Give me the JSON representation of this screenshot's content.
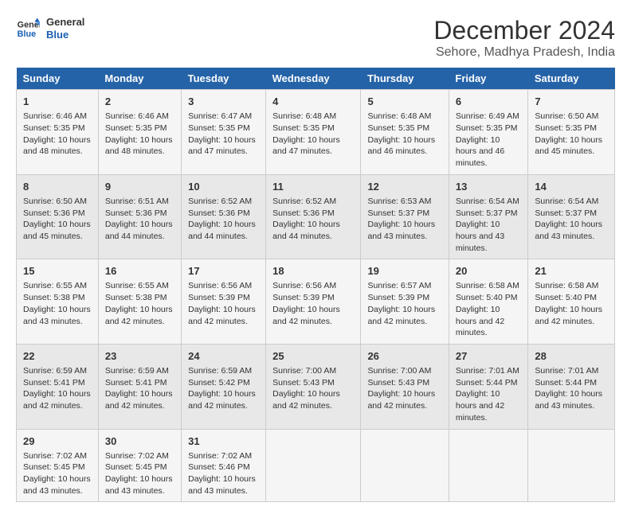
{
  "logo": {
    "line1": "General",
    "line2": "Blue"
  },
  "title": "December 2024",
  "subtitle": "Sehore, Madhya Pradesh, India",
  "days_of_week": [
    "Sunday",
    "Monday",
    "Tuesday",
    "Wednesday",
    "Thursday",
    "Friday",
    "Saturday"
  ],
  "weeks": [
    [
      {
        "day": "1",
        "sunrise": "Sunrise: 6:46 AM",
        "sunset": "Sunset: 5:35 PM",
        "daylight": "Daylight: 10 hours and 48 minutes."
      },
      {
        "day": "2",
        "sunrise": "Sunrise: 6:46 AM",
        "sunset": "Sunset: 5:35 PM",
        "daylight": "Daylight: 10 hours and 48 minutes."
      },
      {
        "day": "3",
        "sunrise": "Sunrise: 6:47 AM",
        "sunset": "Sunset: 5:35 PM",
        "daylight": "Daylight: 10 hours and 47 minutes."
      },
      {
        "day": "4",
        "sunrise": "Sunrise: 6:48 AM",
        "sunset": "Sunset: 5:35 PM",
        "daylight": "Daylight: 10 hours and 47 minutes."
      },
      {
        "day": "5",
        "sunrise": "Sunrise: 6:48 AM",
        "sunset": "Sunset: 5:35 PM",
        "daylight": "Daylight: 10 hours and 46 minutes."
      },
      {
        "day": "6",
        "sunrise": "Sunrise: 6:49 AM",
        "sunset": "Sunset: 5:35 PM",
        "daylight": "Daylight: 10 hours and 46 minutes."
      },
      {
        "day": "7",
        "sunrise": "Sunrise: 6:50 AM",
        "sunset": "Sunset: 5:35 PM",
        "daylight": "Daylight: 10 hours and 45 minutes."
      }
    ],
    [
      {
        "day": "8",
        "sunrise": "Sunrise: 6:50 AM",
        "sunset": "Sunset: 5:36 PM",
        "daylight": "Daylight: 10 hours and 45 minutes."
      },
      {
        "day": "9",
        "sunrise": "Sunrise: 6:51 AM",
        "sunset": "Sunset: 5:36 PM",
        "daylight": "Daylight: 10 hours and 44 minutes."
      },
      {
        "day": "10",
        "sunrise": "Sunrise: 6:52 AM",
        "sunset": "Sunset: 5:36 PM",
        "daylight": "Daylight: 10 hours and 44 minutes."
      },
      {
        "day": "11",
        "sunrise": "Sunrise: 6:52 AM",
        "sunset": "Sunset: 5:36 PM",
        "daylight": "Daylight: 10 hours and 44 minutes."
      },
      {
        "day": "12",
        "sunrise": "Sunrise: 6:53 AM",
        "sunset": "Sunset: 5:37 PM",
        "daylight": "Daylight: 10 hours and 43 minutes."
      },
      {
        "day": "13",
        "sunrise": "Sunrise: 6:54 AM",
        "sunset": "Sunset: 5:37 PM",
        "daylight": "Daylight: 10 hours and 43 minutes."
      },
      {
        "day": "14",
        "sunrise": "Sunrise: 6:54 AM",
        "sunset": "Sunset: 5:37 PM",
        "daylight": "Daylight: 10 hours and 43 minutes."
      }
    ],
    [
      {
        "day": "15",
        "sunrise": "Sunrise: 6:55 AM",
        "sunset": "Sunset: 5:38 PM",
        "daylight": "Daylight: 10 hours and 43 minutes."
      },
      {
        "day": "16",
        "sunrise": "Sunrise: 6:55 AM",
        "sunset": "Sunset: 5:38 PM",
        "daylight": "Daylight: 10 hours and 42 minutes."
      },
      {
        "day": "17",
        "sunrise": "Sunrise: 6:56 AM",
        "sunset": "Sunset: 5:39 PM",
        "daylight": "Daylight: 10 hours and 42 minutes."
      },
      {
        "day": "18",
        "sunrise": "Sunrise: 6:56 AM",
        "sunset": "Sunset: 5:39 PM",
        "daylight": "Daylight: 10 hours and 42 minutes."
      },
      {
        "day": "19",
        "sunrise": "Sunrise: 6:57 AM",
        "sunset": "Sunset: 5:39 PM",
        "daylight": "Daylight: 10 hours and 42 minutes."
      },
      {
        "day": "20",
        "sunrise": "Sunrise: 6:58 AM",
        "sunset": "Sunset: 5:40 PM",
        "daylight": "Daylight: 10 hours and 42 minutes."
      },
      {
        "day": "21",
        "sunrise": "Sunrise: 6:58 AM",
        "sunset": "Sunset: 5:40 PM",
        "daylight": "Daylight: 10 hours and 42 minutes."
      }
    ],
    [
      {
        "day": "22",
        "sunrise": "Sunrise: 6:59 AM",
        "sunset": "Sunset: 5:41 PM",
        "daylight": "Daylight: 10 hours and 42 minutes."
      },
      {
        "day": "23",
        "sunrise": "Sunrise: 6:59 AM",
        "sunset": "Sunset: 5:41 PM",
        "daylight": "Daylight: 10 hours and 42 minutes."
      },
      {
        "day": "24",
        "sunrise": "Sunrise: 6:59 AM",
        "sunset": "Sunset: 5:42 PM",
        "daylight": "Daylight: 10 hours and 42 minutes."
      },
      {
        "day": "25",
        "sunrise": "Sunrise: 7:00 AM",
        "sunset": "Sunset: 5:43 PM",
        "daylight": "Daylight: 10 hours and 42 minutes."
      },
      {
        "day": "26",
        "sunrise": "Sunrise: 7:00 AM",
        "sunset": "Sunset: 5:43 PM",
        "daylight": "Daylight: 10 hours and 42 minutes."
      },
      {
        "day": "27",
        "sunrise": "Sunrise: 7:01 AM",
        "sunset": "Sunset: 5:44 PM",
        "daylight": "Daylight: 10 hours and 42 minutes."
      },
      {
        "day": "28",
        "sunrise": "Sunrise: 7:01 AM",
        "sunset": "Sunset: 5:44 PM",
        "daylight": "Daylight: 10 hours and 43 minutes."
      }
    ],
    [
      {
        "day": "29",
        "sunrise": "Sunrise: 7:02 AM",
        "sunset": "Sunset: 5:45 PM",
        "daylight": "Daylight: 10 hours and 43 minutes."
      },
      {
        "day": "30",
        "sunrise": "Sunrise: 7:02 AM",
        "sunset": "Sunset: 5:45 PM",
        "daylight": "Daylight: 10 hours and 43 minutes."
      },
      {
        "day": "31",
        "sunrise": "Sunrise: 7:02 AM",
        "sunset": "Sunset: 5:46 PM",
        "daylight": "Daylight: 10 hours and 43 minutes."
      },
      null,
      null,
      null,
      null
    ]
  ]
}
